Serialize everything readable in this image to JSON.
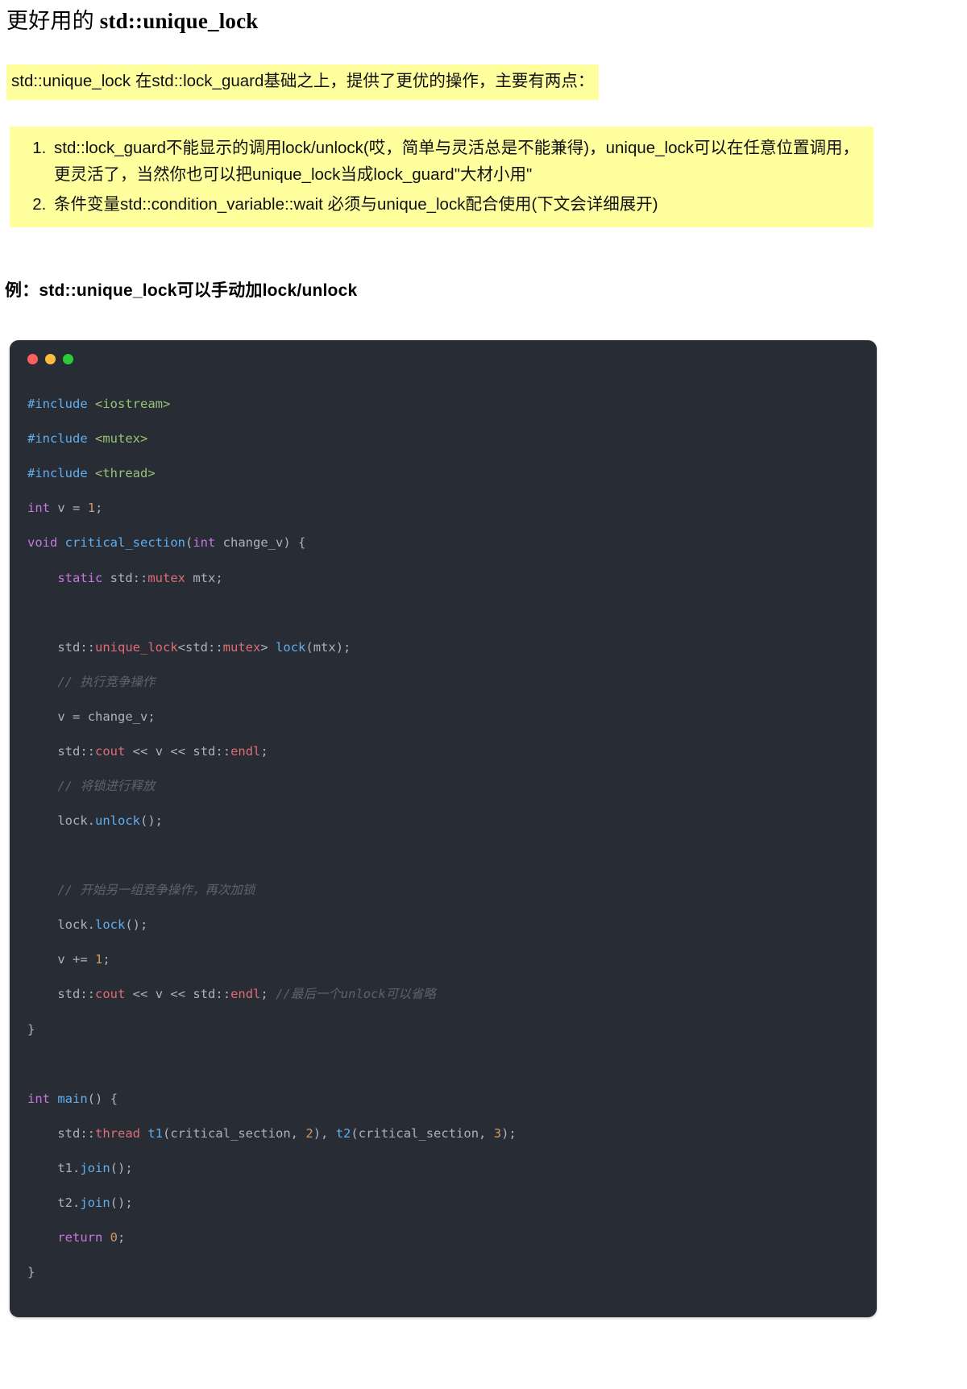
{
  "page": {
    "title_prefix": "更好用的 ",
    "title_code": "std::unique_lock",
    "background_color": "#ffffff",
    "highlight_color": "#ffff9e"
  },
  "intro": {
    "text": "std::unique_lock 在std::lock_guard基础之上，提供了更优的操作，主要有两点："
  },
  "points": {
    "items": [
      "std::lock_guard不能显示的调用lock/unlock(哎，简单与灵活总是不能兼得)，unique_lock可以在任意位置调用，更灵活了，当然你也可以把unique_lock当成lock_guard\"大材小用\"",
      "条件变量std::condition_variable::wait 必须与unique_lock配合使用(下文会详细展开)"
    ]
  },
  "example": {
    "heading": "例：std::unique_lock可以手动加lock/unlock"
  },
  "code_card": {
    "window_dots": [
      "close-red",
      "minimize-yellow",
      "maximize-green"
    ],
    "dot_colors": {
      "red": "#fc625d",
      "yellow": "#fdbc40",
      "green": "#2bcc3b"
    },
    "background_color": "#282c34",
    "language": "cpp",
    "lines": [
      {
        "type": "pre",
        "text": "#include <iostream>"
      },
      {
        "type": "pre",
        "text": "#include <mutex>"
      },
      {
        "type": "pre",
        "text": "#include <thread>"
      },
      {
        "type": "code",
        "text": "int v = 1;"
      },
      {
        "type": "code",
        "text": "void critical_section(int change_v) {"
      },
      {
        "type": "code",
        "text": "    static std::mutex mtx;"
      },
      {
        "type": "blank",
        "text": ""
      },
      {
        "type": "code",
        "text": "    std::unique_lock<std::mutex> lock(mtx);"
      },
      {
        "type": "cmt",
        "text": "    // 执行竞争操作"
      },
      {
        "type": "code",
        "text": "    v = change_v;"
      },
      {
        "type": "code",
        "text": "    std::cout << v << std::endl;"
      },
      {
        "type": "cmt",
        "text": "    // 将锁进行释放"
      },
      {
        "type": "code",
        "text": "    lock.unlock();"
      },
      {
        "type": "blank",
        "text": ""
      },
      {
        "type": "cmt",
        "text": "    // 开始另一组竞争操作，再次加锁"
      },
      {
        "type": "code",
        "text": "    lock.lock();"
      },
      {
        "type": "code",
        "text": "    v += 1;"
      },
      {
        "type": "code",
        "text": "    std::cout << v << std::endl; //最后一个unlock可以省略"
      },
      {
        "type": "code",
        "text": "}"
      },
      {
        "type": "blank",
        "text": ""
      },
      {
        "type": "code",
        "text": "int main() {"
      },
      {
        "type": "code",
        "text": "    std::thread t1(critical_section, 2), t2(critical_section, 3);"
      },
      {
        "type": "code",
        "text": "    t1.join();"
      },
      {
        "type": "code",
        "text": "    t2.join();"
      },
      {
        "type": "code",
        "text": "    return 0;"
      },
      {
        "type": "code",
        "text": "}"
      }
    ],
    "syntax_colors": {
      "preprocessor": "#61afef",
      "include_path": "#98c379",
      "keyword": "#c678dd",
      "function": "#61afef",
      "number": "#d19a66",
      "member": "#e06c75",
      "plain": "#abb2bf",
      "comment": "#5c6370"
    }
  }
}
